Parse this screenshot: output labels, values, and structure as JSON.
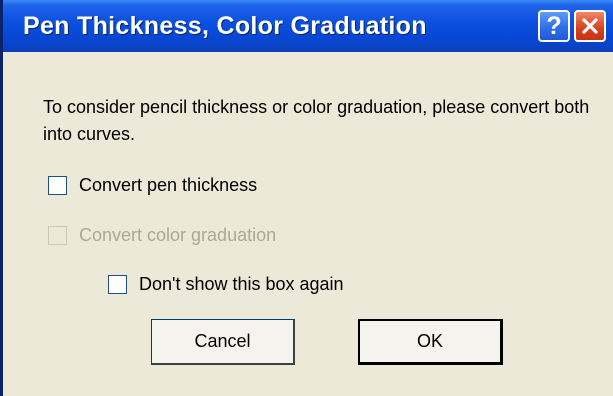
{
  "window": {
    "title": "Pen Thickness, Color Graduation",
    "help_label": "?",
    "close_label": "✕"
  },
  "message": "To consider pencil thickness or color graduation, please convert both into curves.",
  "options": {
    "pen_thickness": {
      "label": "Convert pen thickness",
      "checked": false,
      "enabled": true
    },
    "color_graduation": {
      "label": "Convert color graduation",
      "checked": false,
      "enabled": false
    },
    "dont_show": {
      "label": "Don't show this box again",
      "checked": false,
      "enabled": true
    }
  },
  "buttons": {
    "cancel_label": "Cancel",
    "ok_label": "OK"
  },
  "colors": {
    "titlebar": "#0A4FE0",
    "dialog_bg": "#ECE9D8",
    "close_button": "#D6411C",
    "disabled_text": "#ACA899"
  }
}
